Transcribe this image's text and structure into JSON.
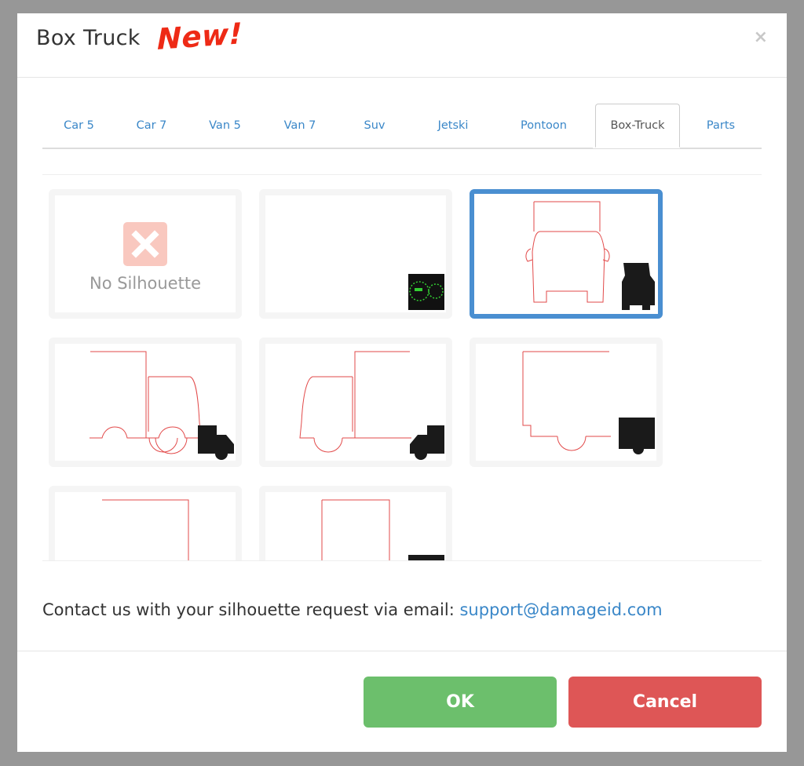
{
  "dialog": {
    "title": "Box Truck",
    "badge": "New!",
    "close_glyph": "×"
  },
  "tabs": [
    {
      "label": "Car 5"
    },
    {
      "label": "Car 7"
    },
    {
      "label": "Van 5"
    },
    {
      "label": "Van 7"
    },
    {
      "label": "Suv"
    },
    {
      "label": "Jetski"
    },
    {
      "label": "Pontoon"
    },
    {
      "label": "Box-Truck",
      "active": true
    },
    {
      "label": "Parts"
    }
  ],
  "tiles": {
    "no_silhouette_label": "No Silhouette",
    "selected_index": 2
  },
  "contact": {
    "text": "Contact us with your silhouette request via email: ",
    "email": "support@damageid.com"
  },
  "buttons": {
    "ok": "OK",
    "cancel": "Cancel"
  },
  "colors": {
    "accent": "#4a8fd1",
    "ok": "#6cbf6c",
    "cancel": "#de5656",
    "outline": "#e24a4a"
  }
}
